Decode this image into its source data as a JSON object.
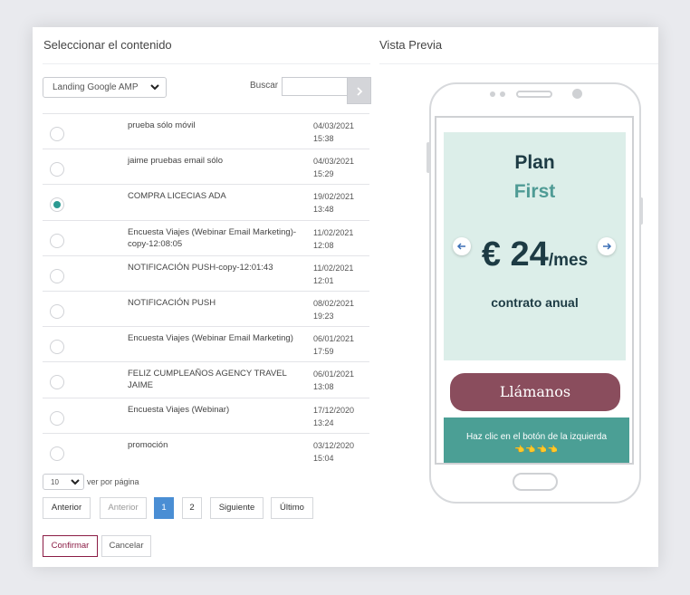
{
  "left_title": "Seleccionar el contenido",
  "right_title": "Vista Previa",
  "filter": {
    "selected": "Landing Google AMP",
    "search_label": "Buscar",
    "search_value": ""
  },
  "rows": [
    {
      "name": "prueba sólo móvil",
      "date": "04/03/2021",
      "time": "15:38",
      "selected": false
    },
    {
      "name": "jaime pruebas email sólo",
      "date": "04/03/2021",
      "time": "15:29",
      "selected": false
    },
    {
      "name": "COMPRA LICECIAS ADA",
      "date": "19/02/2021",
      "time": "13:48",
      "selected": true
    },
    {
      "name": "Encuesta Viajes (Webinar Email Marketing)-copy-12:08:05",
      "date": "11/02/2021",
      "time": "12:08",
      "selected": false
    },
    {
      "name": "NOTIFICACIÓN PUSH-copy-12:01:43",
      "date": "11/02/2021",
      "time": "12:01",
      "selected": false
    },
    {
      "name": "NOTIFICACIÓN PUSH",
      "date": "08/02/2021",
      "time": "19:23",
      "selected": false
    },
    {
      "name": "Encuesta Viajes (Webinar Email Marketing)",
      "date": "06/01/2021",
      "time": "17:59",
      "selected": false
    },
    {
      "name": "FELIZ CUMPLEAÑOS AGENCY TRAVEL JAIME",
      "date": "06/01/2021",
      "time": "13:08",
      "selected": false
    },
    {
      "name": "Encuesta Viajes (Webinar)",
      "date": "17/12/2020",
      "time": "13:24",
      "selected": false
    },
    {
      "name": "promoción",
      "date": "03/12/2020",
      "time": "15:04",
      "selected": false
    }
  ],
  "pagination": {
    "per_page": "10",
    "per_page_label": "ver por página",
    "first": "Anterior",
    "prev": "Anterior",
    "pages": [
      "1",
      "2"
    ],
    "current_page": "1",
    "next": "Siguiente",
    "last": "Último"
  },
  "actions": {
    "confirm": "Confirmar",
    "cancel": "Cancelar"
  },
  "preview": {
    "plan_title": "Plan",
    "plan_sub": "First",
    "price": "€ 24",
    "period": "/mes",
    "contract": "contrato anual",
    "call_button": "Llámanos",
    "cta_text": "Haz clic en el botón de la izquierda",
    "cta_icons": "👈👈👈👈"
  },
  "colors": {
    "accent": "#2c9a92",
    "active_page": "#4a8ed4",
    "call_button": "#8a4d5d",
    "cta_bg": "#4b9f95",
    "card_bg": "#dceee9"
  }
}
